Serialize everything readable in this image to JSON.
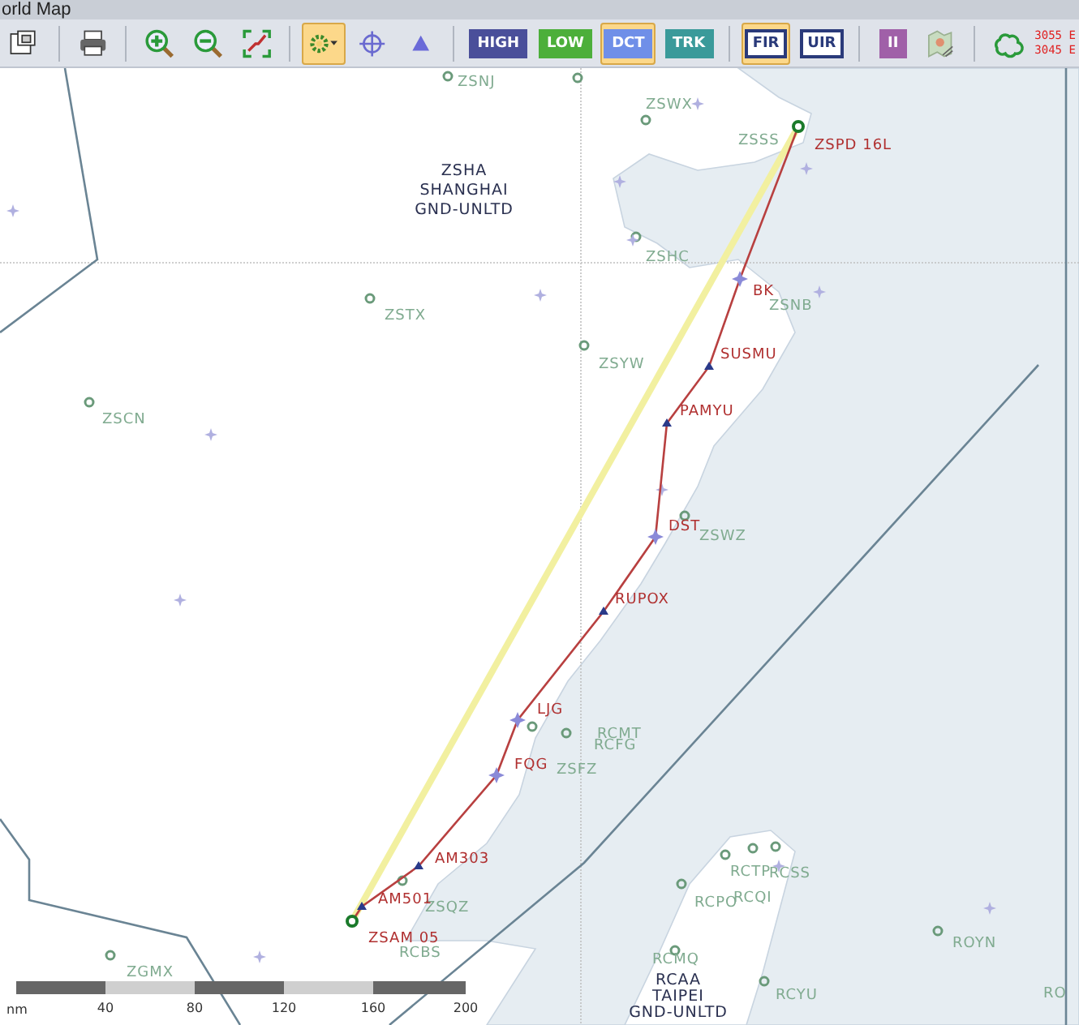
{
  "window": {
    "title": "orld Map"
  },
  "toolbar": {
    "groups": [
      [
        {
          "kind": "icon",
          "selected": false
        }
      ],
      [
        {
          "kind": "icon",
          "selected": false
        }
      ],
      [
        {
          "kind": "icon",
          "selected": false
        },
        {
          "kind": "icon",
          "selected": false
        },
        {
          "kind": "icon",
          "selected": false
        }
      ],
      [
        {
          "kind": "icon",
          "selected": true
        },
        {
          "kind": "icon",
          "selected": false
        },
        {
          "kind": "icon",
          "selected": false
        }
      ],
      [
        {
          "kind": "label",
          "label": "HIGH",
          "color": "#4a4f9a",
          "selected": false
        },
        {
          "kind": "label",
          "label": "LOW",
          "color": "#4caf3a",
          "selected": false
        },
        {
          "kind": "label",
          "label": "DCT",
          "color": "#6f8fe8",
          "selected": true
        },
        {
          "kind": "label",
          "label": "TRK",
          "color": "#3a9a9a",
          "selected": false
        }
      ],
      [
        {
          "kind": "label",
          "label": "FIR",
          "color": "#ffffff",
          "selected": true
        },
        {
          "kind": "label",
          "label": "UIR",
          "color": "#ffffff",
          "selected": false
        }
      ],
      [
        {
          "kind": "label",
          "label": "II",
          "color": "#a060a8",
          "selected": false
        },
        {
          "kind": "icon",
          "selected": false
        }
      ],
      [
        {
          "kind": "icon",
          "selected": false
        },
        {
          "kind": "readout",
          "lines": [
            "3055 E",
            "3045 E"
          ]
        }
      ]
    ]
  },
  "map": {
    "fir_labels": [
      {
        "lines": [
          "ZSHA",
          "SHANGHAI",
          "GND-UNLTD"
        ]
      },
      {
        "lines": [
          "RCAA",
          "TAIPEI",
          "GND-UNLTD"
        ]
      }
    ],
    "airports": [
      "ZSNJ",
      "ZSWX",
      "ZSSS",
      "ZSHC",
      "ZSNB",
      "ZSTX",
      "ZSYW",
      "ZSCN",
      "ZSWZ",
      "RCMT",
      "RCFG",
      "ZSFZ",
      "ZSQZ",
      "RCBS",
      "ZGMX",
      "RCTP",
      "RCSS",
      "RCPO",
      "RCQI",
      "RCMQ",
      "RCYU",
      "ROYN",
      "RO"
    ],
    "route": [
      {
        "name": "ZSPD 16L",
        "kind": "airport"
      },
      {
        "name": "BK",
        "kind": "vor"
      },
      {
        "name": "SUSMU",
        "kind": "fix"
      },
      {
        "name": "PAMYU",
        "kind": "fix"
      },
      {
        "name": "DST",
        "kind": "vor"
      },
      {
        "name": "RUPOX",
        "kind": "fix"
      },
      {
        "name": "LJG",
        "kind": "vor"
      },
      {
        "name": "FQG",
        "kind": "vor"
      },
      {
        "name": "AM303",
        "kind": "fix"
      },
      {
        "name": "AM501",
        "kind": "fix"
      },
      {
        "name": "ZSAM 05",
        "kind": "airport"
      }
    ],
    "scale": {
      "unit": "nm",
      "ticks": [
        "40",
        "80",
        "120",
        "160",
        "200"
      ]
    }
  }
}
